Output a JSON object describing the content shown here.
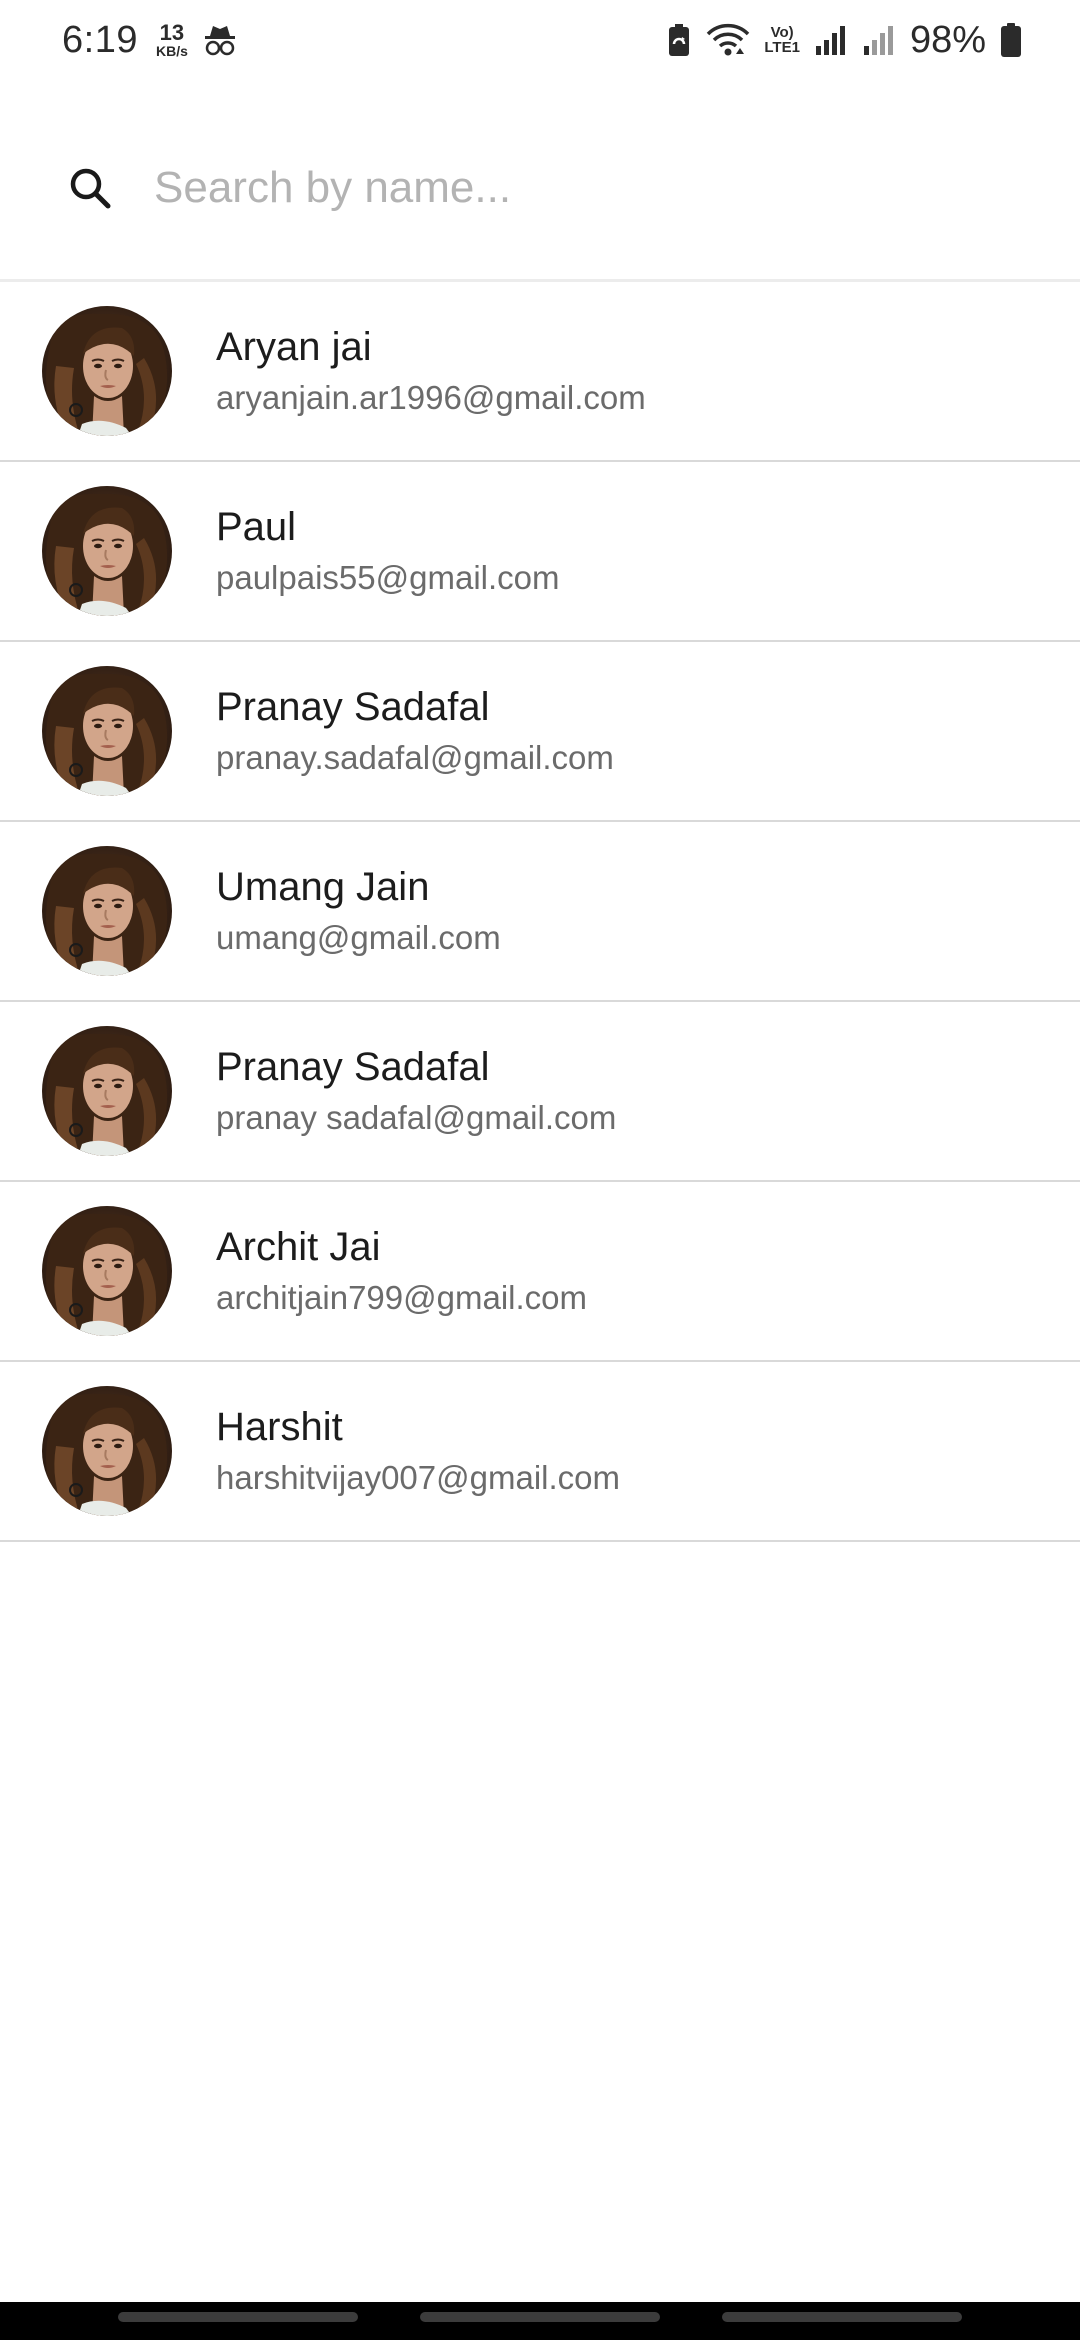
{
  "status_bar": {
    "time": "6:19",
    "net_speed_value": "13",
    "net_speed_unit": "KB/s",
    "volte_top": "Vo)",
    "volte_bottom": "LTE1",
    "battery_percent": "98%"
  },
  "search": {
    "placeholder": "Search by name...",
    "value": ""
  },
  "contacts": [
    {
      "name": "Aryan jai",
      "email": "aryanjain.ar1996@gmail.com"
    },
    {
      "name": "Paul",
      "email": "paulpais55@gmail.com"
    },
    {
      "name": "Pranay Sadafal",
      "email": "pranay.sadafal@gmail.com"
    },
    {
      "name": "Umang Jain",
      "email": "umang@gmail.com"
    },
    {
      "name": "Pranay Sadafal",
      "email": "pranay sadafal@gmail.com"
    },
    {
      "name": "Archit Jai",
      "email": "architjain799@gmail.com"
    },
    {
      "name": "Harshit",
      "email": "harshitvijay007@gmail.com"
    }
  ],
  "icons": {
    "search": "search-icon",
    "incognito": "incognito-icon",
    "battery_saver": "battery-saver-icon",
    "wifi": "wifi-icon",
    "signal": "signal-icon",
    "battery": "battery-icon",
    "avatar": "avatar-image"
  },
  "colors": {
    "placeholder": "#b3b3b3",
    "name_text": "#1c1c1c",
    "email_text": "#6b6b6b",
    "divider": "#d9d9d9",
    "nav_bar": "#000000"
  }
}
